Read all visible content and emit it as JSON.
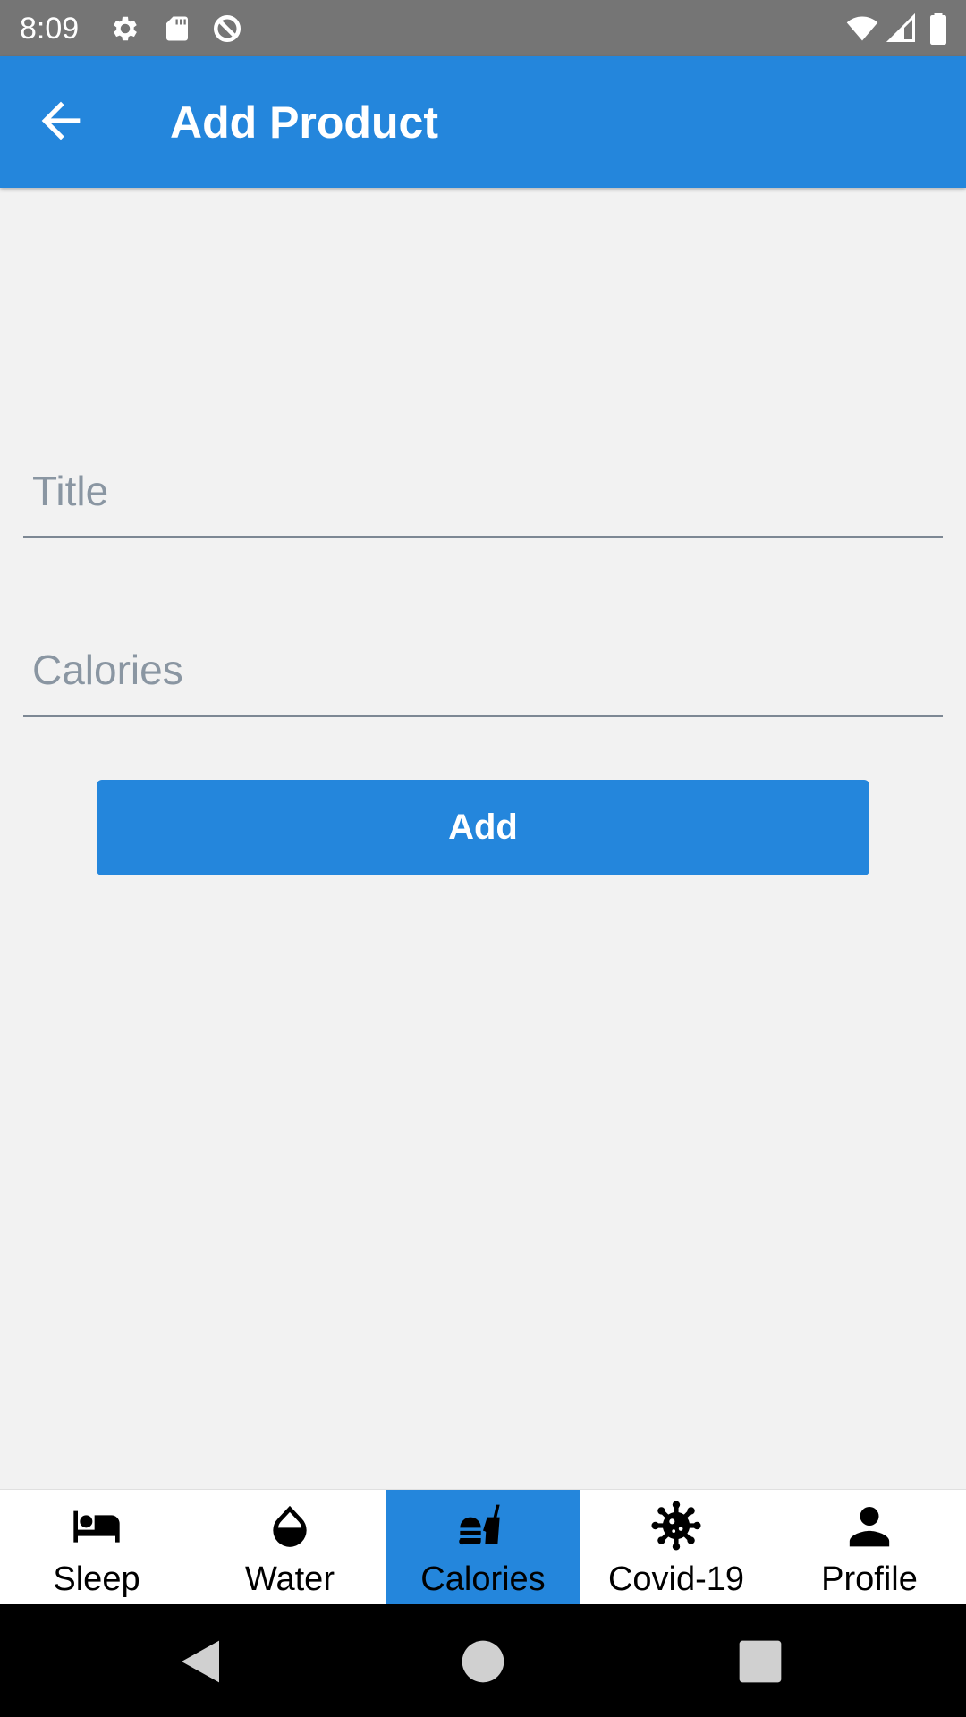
{
  "status_bar": {
    "time": "8:09",
    "icons": [
      "settings-icon",
      "sd-card-icon",
      "data-saver-icon",
      "wifi-icon",
      "cell-signal-icon",
      "battery-icon"
    ],
    "background": "#757575"
  },
  "app_bar": {
    "title": "Add Product",
    "back_icon": "arrow-back-icon",
    "background": "#2486dc"
  },
  "form": {
    "title_placeholder": "Title",
    "title_value": "",
    "calories_placeholder": "Calories",
    "calories_value": "",
    "add_label": "Add"
  },
  "bottom_nav": {
    "active": "Calories",
    "active_color": "#2486dc",
    "items": [
      {
        "label": "Sleep",
        "icon": "bed-icon"
      },
      {
        "label": "Water",
        "icon": "water-drop-icon"
      },
      {
        "label": "Calories",
        "icon": "fastfood-icon"
      },
      {
        "label": "Covid-19",
        "icon": "virus-icon"
      },
      {
        "label": "Profile",
        "icon": "person-icon"
      }
    ]
  },
  "system_nav": {
    "buttons": [
      "back-triangle-icon",
      "home-circle-icon",
      "recents-square-icon"
    ]
  }
}
